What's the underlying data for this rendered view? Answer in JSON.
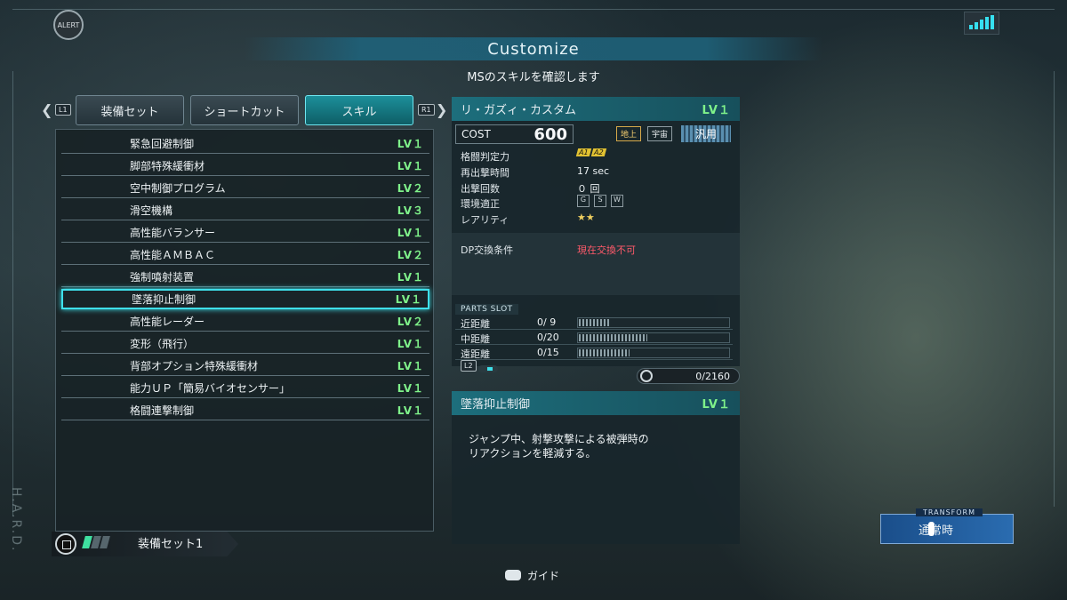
{
  "header": {
    "alert_label": "ALERT",
    "title": "Customize",
    "subtitle": "MSのスキルを確認します"
  },
  "tabs": {
    "left_tag": "L1",
    "right_tag": "R1",
    "items": [
      {
        "label": "装備セット"
      },
      {
        "label": "ショートカット"
      },
      {
        "label": "スキル"
      }
    ],
    "active_index": 2
  },
  "skills": [
    {
      "name": "緊急回避制御",
      "level": "LV１"
    },
    {
      "name": "脚部特殊緩衝材",
      "level": "LV１"
    },
    {
      "name": "空中制御プログラム",
      "level": "LV２"
    },
    {
      "name": "滑空機構",
      "level": "LV３"
    },
    {
      "name": "高性能バランサー",
      "level": "LV１"
    },
    {
      "name": "高性能ＡＭＢＡＣ",
      "level": "LV２"
    },
    {
      "name": "強制噴射装置",
      "level": "LV１"
    },
    {
      "name": "墜落抑止制御",
      "level": "LV１",
      "selected": true
    },
    {
      "name": "高性能レーダー",
      "level": "LV２"
    },
    {
      "name": "変形（飛行）",
      "level": "LV１"
    },
    {
      "name": "背部オプション特殊緩衝材",
      "level": "LV１"
    },
    {
      "name": "能力ＵＰ「簡易バイオセンサー」",
      "level": "LV１"
    },
    {
      "name": "格闘連撃制御",
      "level": "LV１"
    }
  ],
  "loadout": {
    "label": "装備セット1"
  },
  "unit": {
    "name": "リ・ガズィ・カスタム",
    "level": "LV１",
    "cost_label": "COST",
    "cost_value": "600",
    "terrain_ground": "地上",
    "terrain_space": "宇宙",
    "type": "汎用",
    "stats": [
      {
        "key": "格闘判定力",
        "value": ""
      },
      {
        "key": "再出撃時間",
        "value": "17 sec"
      },
      {
        "key": "出撃回数",
        "value": "０ 回"
      },
      {
        "key": "環境適正",
        "value": ""
      },
      {
        "key": "レアリティ",
        "value": "★★"
      }
    ],
    "melee_grade_labels": [
      "A1",
      "A2"
    ],
    "env_labels": [
      "G",
      "S",
      "W"
    ],
    "dp_label": "DP交換条件",
    "dp_value": "現在交換不可",
    "parts_slot_label": "PARTS SLOT",
    "slots": [
      {
        "name": "近距離",
        "value": "0/ 9",
        "fill": 0.21
      },
      {
        "name": "中距離",
        "value": "0/20",
        "fill": 0.46
      },
      {
        "name": "遠距離",
        "value": "0/15",
        "fill": 0.34
      }
    ],
    "l2_tag": "L2",
    "capacity": "0/2160"
  },
  "skill_detail": {
    "name": "墜落抑止制御",
    "level": "LV１",
    "description": "ジャンプ中、射撃攻撃による被弾時の\nリアクションを軽減する。"
  },
  "transform": {
    "tag": "TRANSFORM",
    "label": "通常時"
  },
  "footer": {
    "guide_label": "ガイド"
  },
  "watermark": "H.A.R.D.",
  "colors": {
    "accent": "#3ee0ea",
    "level": "#7ff28a",
    "dp_warning": "#ff5a6a",
    "header": "#1d6e7c"
  }
}
